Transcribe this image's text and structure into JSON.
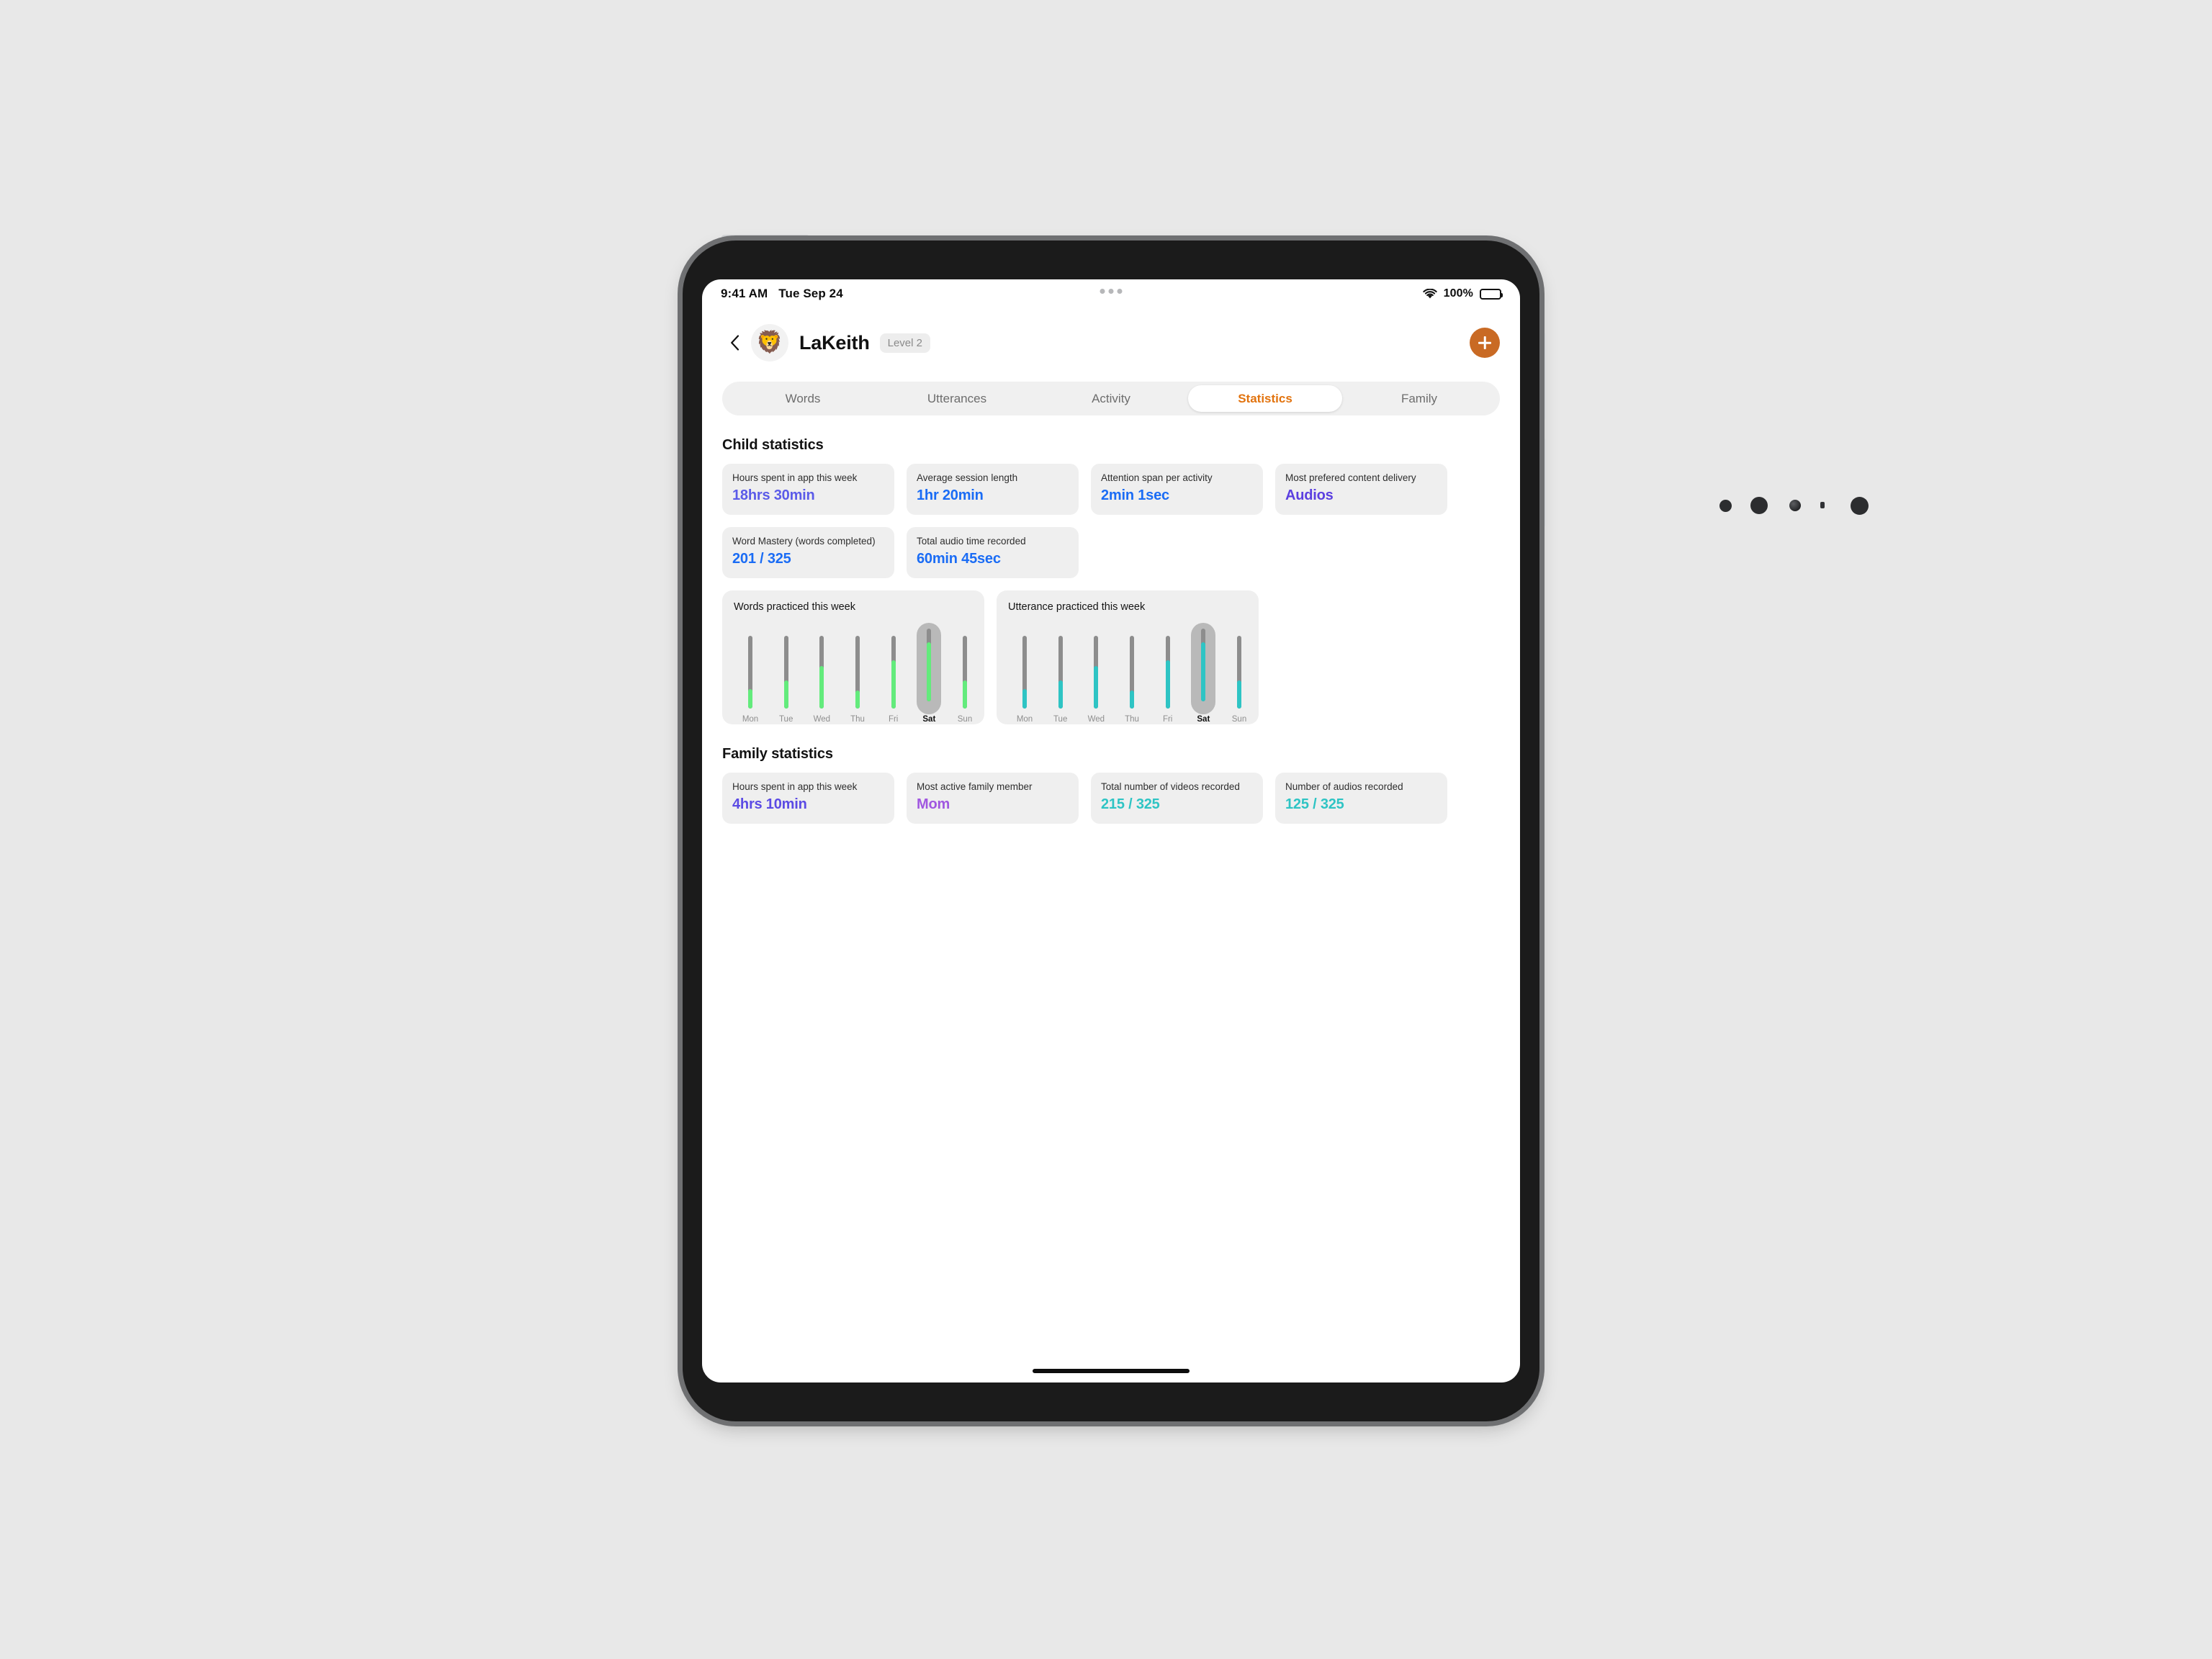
{
  "statusbar": {
    "time": "9:41 AM",
    "date": "Tue Sep 24",
    "battery_percent": "100%",
    "wifi_icon": "wifi-icon",
    "battery_icon": "battery-full-icon",
    "multitask_icon": "multitask-handle-icon"
  },
  "header": {
    "back_icon": "chevron-left-icon",
    "avatar_icon": "lion-avatar",
    "avatar_glyph": "🦁",
    "child_name": "LaKeith",
    "level_badge": "Level 2",
    "add_icon": "plus-icon",
    "accent_color": "#c96a24"
  },
  "tabs": [
    {
      "label": "Words",
      "active": false
    },
    {
      "label": "Utterances",
      "active": false
    },
    {
      "label": "Activity",
      "active": false
    },
    {
      "label": "Statistics",
      "active": true
    },
    {
      "label": "Family",
      "active": false
    }
  ],
  "child_section": {
    "title": "Child statistics",
    "cards": [
      {
        "label": "Hours spent in app this week",
        "value": "18hrs 30min",
        "color": "#5b5be8"
      },
      {
        "label": "Average session length",
        "value": "1hr 20min",
        "color": "#1a6cf5"
      },
      {
        "label": "Attention span per activity",
        "value": "2min 1sec",
        "color": "#1a6cf5"
      },
      {
        "label": "Most prefered content delivery",
        "value": "Audios",
        "color": "#5b3fe0"
      },
      {
        "label": "Word Mastery (words completed)",
        "value": "201 / 325",
        "color": "#1a6cf5"
      },
      {
        "label": "Total audio time recorded",
        "value": "60min 45sec",
        "color": "#1a6cf5"
      }
    ]
  },
  "family_section": {
    "title": "Family statistics",
    "cards": [
      {
        "label": "Hours spent in app this week",
        "value": "4hrs 10min",
        "color": "#5b4be4"
      },
      {
        "label": "Most active family member",
        "value": "Mom",
        "color": "#a057e0"
      },
      {
        "label": "Total number of videos recorded",
        "value": "215 / 325",
        "color": "#2ec4c4"
      },
      {
        "label": "Number of audios recorded",
        "value": "125 / 325",
        "color": "#2ec4c4"
      }
    ]
  },
  "chart_data": [
    {
      "type": "bar",
      "title": "Words practiced this week",
      "xlabel": "",
      "ylabel": "",
      "ylim": [
        0,
        100
      ],
      "grid": false,
      "legend": "none",
      "orientation": "vertical",
      "fill_color": "#63eb7c",
      "track_color": "#8d8d8d",
      "highlight_color": "#b9b9b9",
      "highlighted_category": "Sat",
      "categories": [
        "Mon",
        "Tue",
        "Wed",
        "Thu",
        "Fri",
        "Sat",
        "Sun"
      ],
      "values": [
        27,
        39,
        58,
        25,
        66,
        81,
        39
      ]
    },
    {
      "type": "bar",
      "title": "Utterance practiced this week",
      "xlabel": "",
      "ylabel": "",
      "ylim": [
        0,
        100
      ],
      "grid": false,
      "legend": "none",
      "orientation": "vertical",
      "fill_color": "#2ec4c4",
      "track_color": "#8d8d8d",
      "highlight_color": "#b9b9b9",
      "highlighted_category": "Sat",
      "categories": [
        "Mon",
        "Tue",
        "Wed",
        "Thu",
        "Fri",
        "Sat",
        "Sun"
      ],
      "values": [
        27,
        39,
        58,
        25,
        66,
        81,
        39
      ]
    }
  ]
}
